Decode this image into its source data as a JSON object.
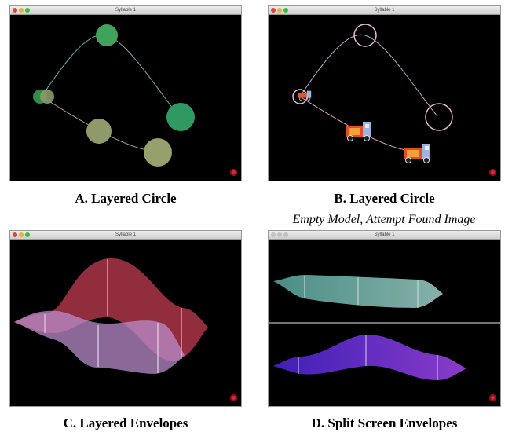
{
  "panels": [
    {
      "window_title": "Syllable 1",
      "caption": "A. Layered Circle"
    },
    {
      "window_title": "Syllable 1",
      "caption": "B. Layered Circle",
      "subcaption": "Empty Model, Attempt Found Image"
    },
    {
      "window_title": "Syllable 1",
      "caption": "C. Layered Envelopes"
    },
    {
      "window_title": "Syllable 1",
      "caption": "D. Split Screen Envelopes"
    }
  ]
}
